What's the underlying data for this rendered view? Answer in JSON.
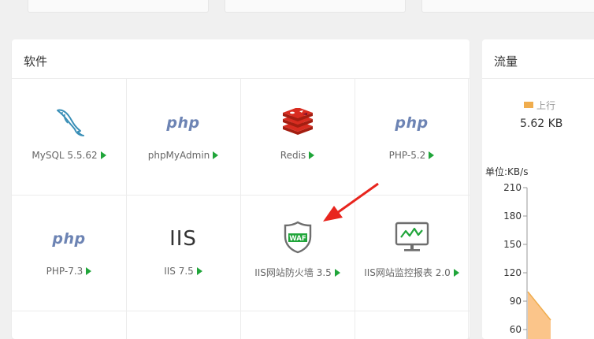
{
  "software": {
    "title": "软件",
    "items": [
      {
        "label": "MySQL 5.5.62",
        "icon": "mysql-dolphin-icon"
      },
      {
        "label": "phpMyAdmin",
        "icon": "php-logo-icon",
        "icon_text": "php"
      },
      {
        "label": "Redis",
        "icon": "redis-icon"
      },
      {
        "label": "PHP-5.2",
        "icon": "php-logo-icon",
        "icon_text": "php"
      },
      {
        "label": "PHP-7.3",
        "icon": "php-logo-icon",
        "icon_text": "php"
      },
      {
        "label": "IIS 7.5",
        "icon": "iis-logo-icon",
        "icon_text": "IIS"
      },
      {
        "label": "IIS网站防火墙 3.5",
        "icon": "waf-shield-icon",
        "icon_text": "WAF"
      },
      {
        "label": "IIS网站监控报表 2.0",
        "icon": "monitor-chart-icon"
      }
    ]
  },
  "traffic": {
    "title": "流量",
    "legend_up": "上行",
    "up_value": "5.62 KB",
    "unit": "单位:KB/s"
  },
  "colors": {
    "accent_green": "#20a53a",
    "upload_series": "#f0ad4e",
    "php_blue": "#6d84b4",
    "redis_red": "#c6302b",
    "arrow_red": "#e8251e"
  },
  "chart_data": {
    "type": "area",
    "ylabel": "单位:KB/s",
    "yticks": [
      "210",
      "180",
      "150",
      "120",
      "90",
      "60"
    ],
    "ylim": [
      60,
      210
    ],
    "series": [
      {
        "name": "上行",
        "values": [
          100,
          70
        ]
      }
    ],
    "grid": false
  }
}
